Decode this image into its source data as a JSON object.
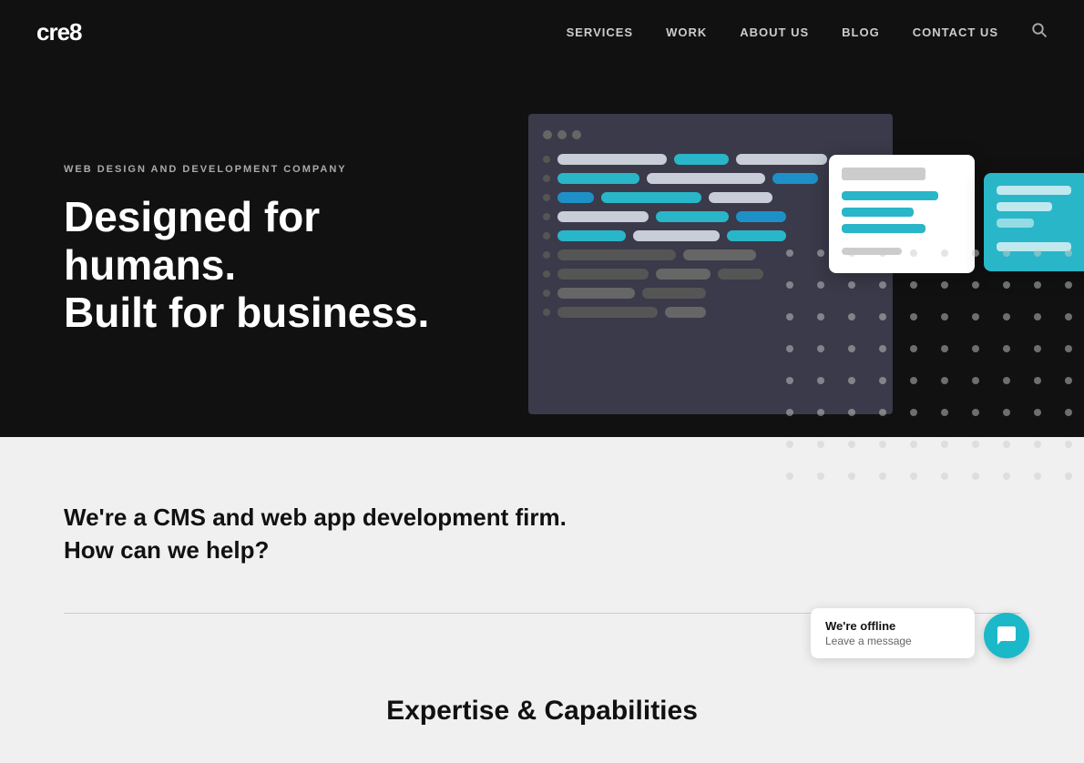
{
  "logo": {
    "text": "cre8"
  },
  "nav": {
    "items": [
      {
        "label": "SERVICES",
        "href": "#"
      },
      {
        "label": "WORK",
        "href": "#"
      },
      {
        "label": "ABOUT US",
        "href": "#"
      },
      {
        "label": "BLOG",
        "href": "#"
      },
      {
        "label": "CONTACT US",
        "href": "#"
      }
    ]
  },
  "hero": {
    "subtitle": "WEB DESIGN AND DEVELOPMENT COMPANY",
    "title_line1": "Designed for humans.",
    "title_line2": "Built for business."
  },
  "intro": {
    "text": "We're a CMS and web app development firm. How can we help?"
  },
  "expertise": {
    "title": "Expertise & Capabilities"
  },
  "chat": {
    "title": "We're offline",
    "subtitle": "Leave a message"
  }
}
